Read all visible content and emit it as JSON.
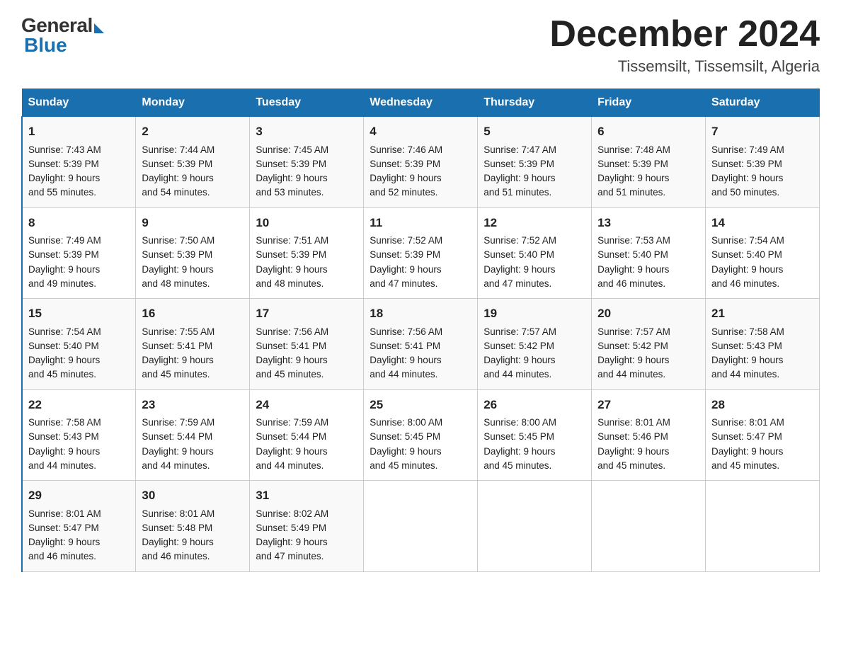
{
  "logo": {
    "general": "General",
    "blue": "Blue"
  },
  "title": {
    "month_year": "December 2024",
    "location": "Tissemsilt, Tissemsilt, Algeria"
  },
  "headers": [
    "Sunday",
    "Monday",
    "Tuesday",
    "Wednesday",
    "Thursday",
    "Friday",
    "Saturday"
  ],
  "weeks": [
    [
      {
        "day": "1",
        "sunrise": "7:43 AM",
        "sunset": "5:39 PM",
        "daylight": "9 hours and 55 minutes."
      },
      {
        "day": "2",
        "sunrise": "7:44 AM",
        "sunset": "5:39 PM",
        "daylight": "9 hours and 54 minutes."
      },
      {
        "day": "3",
        "sunrise": "7:45 AM",
        "sunset": "5:39 PM",
        "daylight": "9 hours and 53 minutes."
      },
      {
        "day": "4",
        "sunrise": "7:46 AM",
        "sunset": "5:39 PM",
        "daylight": "9 hours and 52 minutes."
      },
      {
        "day": "5",
        "sunrise": "7:47 AM",
        "sunset": "5:39 PM",
        "daylight": "9 hours and 51 minutes."
      },
      {
        "day": "6",
        "sunrise": "7:48 AM",
        "sunset": "5:39 PM",
        "daylight": "9 hours and 51 minutes."
      },
      {
        "day": "7",
        "sunrise": "7:49 AM",
        "sunset": "5:39 PM",
        "daylight": "9 hours and 50 minutes."
      }
    ],
    [
      {
        "day": "8",
        "sunrise": "7:49 AM",
        "sunset": "5:39 PM",
        "daylight": "9 hours and 49 minutes."
      },
      {
        "day": "9",
        "sunrise": "7:50 AM",
        "sunset": "5:39 PM",
        "daylight": "9 hours and 48 minutes."
      },
      {
        "day": "10",
        "sunrise": "7:51 AM",
        "sunset": "5:39 PM",
        "daylight": "9 hours and 48 minutes."
      },
      {
        "day": "11",
        "sunrise": "7:52 AM",
        "sunset": "5:39 PM",
        "daylight": "9 hours and 47 minutes."
      },
      {
        "day": "12",
        "sunrise": "7:52 AM",
        "sunset": "5:40 PM",
        "daylight": "9 hours and 47 minutes."
      },
      {
        "day": "13",
        "sunrise": "7:53 AM",
        "sunset": "5:40 PM",
        "daylight": "9 hours and 46 minutes."
      },
      {
        "day": "14",
        "sunrise": "7:54 AM",
        "sunset": "5:40 PM",
        "daylight": "9 hours and 46 minutes."
      }
    ],
    [
      {
        "day": "15",
        "sunrise": "7:54 AM",
        "sunset": "5:40 PM",
        "daylight": "9 hours and 45 minutes."
      },
      {
        "day": "16",
        "sunrise": "7:55 AM",
        "sunset": "5:41 PM",
        "daylight": "9 hours and 45 minutes."
      },
      {
        "day": "17",
        "sunrise": "7:56 AM",
        "sunset": "5:41 PM",
        "daylight": "9 hours and 45 minutes."
      },
      {
        "day": "18",
        "sunrise": "7:56 AM",
        "sunset": "5:41 PM",
        "daylight": "9 hours and 44 minutes."
      },
      {
        "day": "19",
        "sunrise": "7:57 AM",
        "sunset": "5:42 PM",
        "daylight": "9 hours and 44 minutes."
      },
      {
        "day": "20",
        "sunrise": "7:57 AM",
        "sunset": "5:42 PM",
        "daylight": "9 hours and 44 minutes."
      },
      {
        "day": "21",
        "sunrise": "7:58 AM",
        "sunset": "5:43 PM",
        "daylight": "9 hours and 44 minutes."
      }
    ],
    [
      {
        "day": "22",
        "sunrise": "7:58 AM",
        "sunset": "5:43 PM",
        "daylight": "9 hours and 44 minutes."
      },
      {
        "day": "23",
        "sunrise": "7:59 AM",
        "sunset": "5:44 PM",
        "daylight": "9 hours and 44 minutes."
      },
      {
        "day": "24",
        "sunrise": "7:59 AM",
        "sunset": "5:44 PM",
        "daylight": "9 hours and 44 minutes."
      },
      {
        "day": "25",
        "sunrise": "8:00 AM",
        "sunset": "5:45 PM",
        "daylight": "9 hours and 45 minutes."
      },
      {
        "day": "26",
        "sunrise": "8:00 AM",
        "sunset": "5:45 PM",
        "daylight": "9 hours and 45 minutes."
      },
      {
        "day": "27",
        "sunrise": "8:01 AM",
        "sunset": "5:46 PM",
        "daylight": "9 hours and 45 minutes."
      },
      {
        "day": "28",
        "sunrise": "8:01 AM",
        "sunset": "5:47 PM",
        "daylight": "9 hours and 45 minutes."
      }
    ],
    [
      {
        "day": "29",
        "sunrise": "8:01 AM",
        "sunset": "5:47 PM",
        "daylight": "9 hours and 46 minutes."
      },
      {
        "day": "30",
        "sunrise": "8:01 AM",
        "sunset": "5:48 PM",
        "daylight": "9 hours and 46 minutes."
      },
      {
        "day": "31",
        "sunrise": "8:02 AM",
        "sunset": "5:49 PM",
        "daylight": "9 hours and 47 minutes."
      },
      null,
      null,
      null,
      null
    ]
  ],
  "labels": {
    "sunrise": "Sunrise:",
    "sunset": "Sunset:",
    "daylight": "Daylight:"
  }
}
